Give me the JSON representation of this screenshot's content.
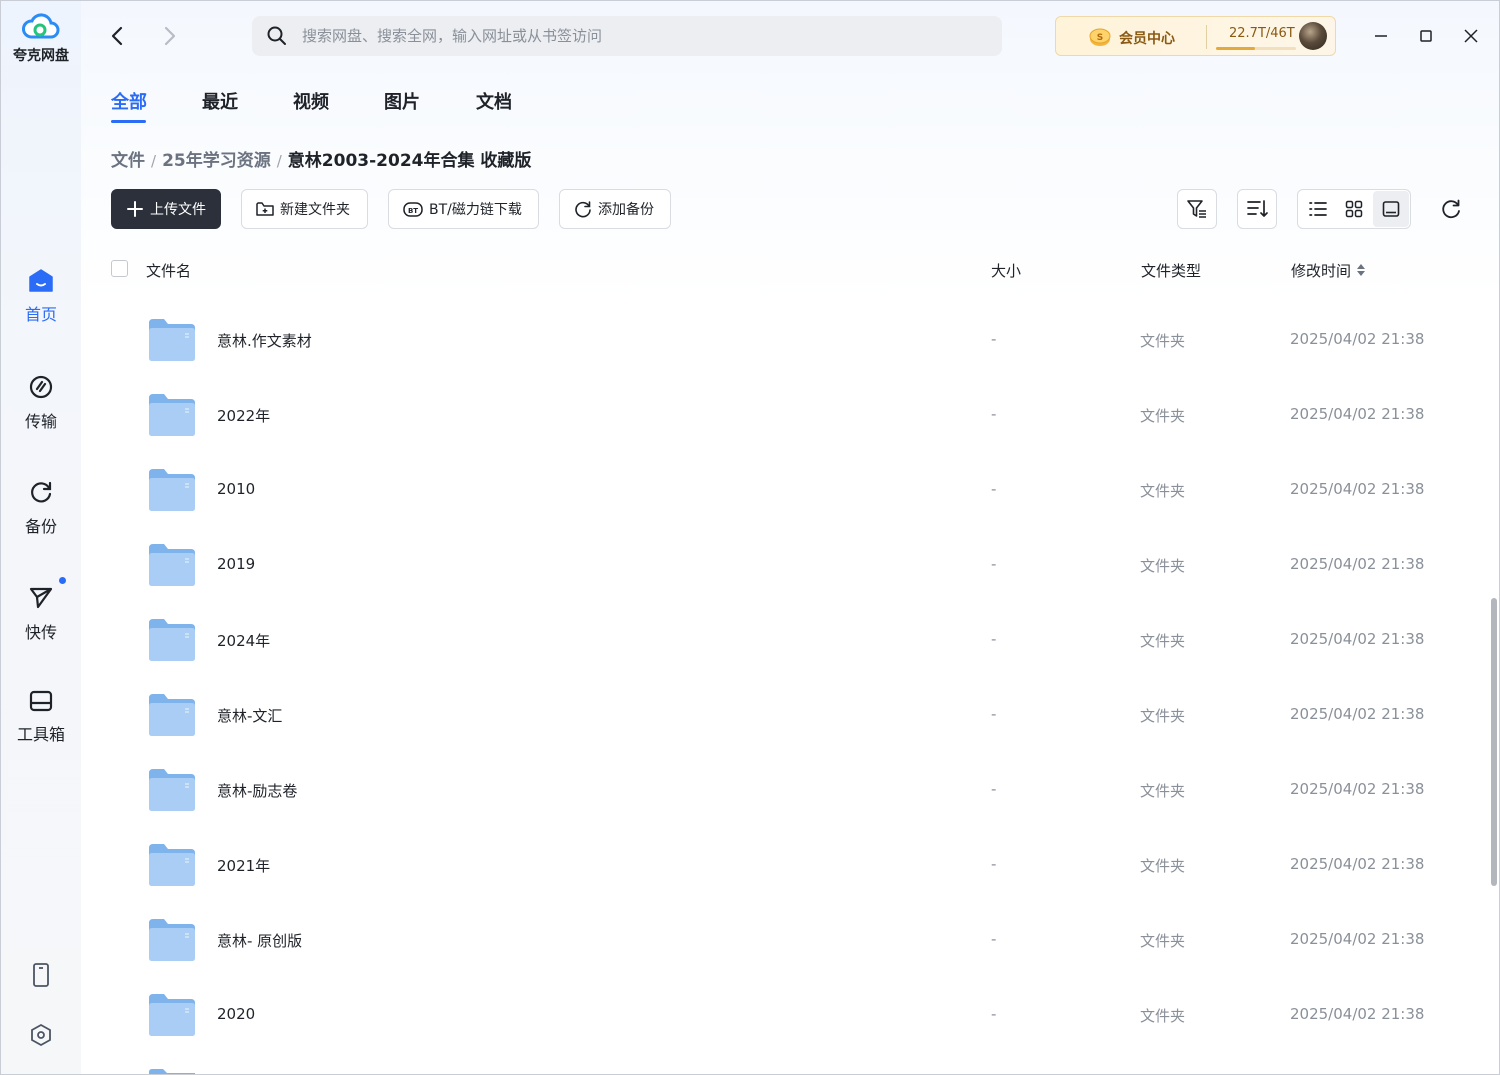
{
  "app": {
    "logo_text": "夸克网盘"
  },
  "colors": {
    "accent": "#2b6cf6",
    "primary_button": "#2b303b",
    "folder": "#7fb3ec",
    "vip_text": "#8a5a12"
  },
  "sidebar": {
    "items": [
      {
        "label": "首页",
        "icon": "home-icon",
        "active": true
      },
      {
        "label": "传输",
        "icon": "transfer-icon",
        "active": false
      },
      {
        "label": "备份",
        "icon": "backup-icon",
        "active": false
      },
      {
        "label": "快传",
        "icon": "send-icon",
        "active": false,
        "has_dot": true
      },
      {
        "label": "工具箱",
        "icon": "toolbox-icon",
        "active": false
      }
    ],
    "bottom_icons": [
      "phone-icon",
      "settings-icon"
    ]
  },
  "header": {
    "search_placeholder": "搜索网盘、搜索全网，输入网址或从书签访问",
    "vip_label": "会员中心",
    "storage": "22.7T/46T",
    "storage_used_fraction": 0.49
  },
  "tabs": [
    {
      "label": "全部",
      "active": true
    },
    {
      "label": "最近",
      "active": false
    },
    {
      "label": "视频",
      "active": false
    },
    {
      "label": "图片",
      "active": false
    },
    {
      "label": "文档",
      "active": false
    }
  ],
  "breadcrumb": {
    "items": [
      "文件",
      "25年学习资源"
    ],
    "separator": "/",
    "current": "意林2003-2024年合集 收藏版"
  },
  "toolbar": {
    "upload": "上传文件",
    "new_folder": "新建文件夹",
    "bt_download": "BT/磁力链下载",
    "add_backup": "添加备份"
  },
  "table": {
    "headers": {
      "name": "文件名",
      "size": "大小",
      "type": "文件类型",
      "modified": "修改时间"
    },
    "rows": [
      {
        "name": "意林.作文素材",
        "size": "-",
        "type": "文件夹",
        "modified": "2025/04/02 21:38"
      },
      {
        "name": "2022年",
        "size": "-",
        "type": "文件夹",
        "modified": "2025/04/02 21:38"
      },
      {
        "name": "2010",
        "size": "-",
        "type": "文件夹",
        "modified": "2025/04/02 21:38"
      },
      {
        "name": "2019",
        "size": "-",
        "type": "文件夹",
        "modified": "2025/04/02 21:38"
      },
      {
        "name": "2024年",
        "size": "-",
        "type": "文件夹",
        "modified": "2025/04/02 21:38"
      },
      {
        "name": "意林-文汇",
        "size": "-",
        "type": "文件夹",
        "modified": "2025/04/02 21:38"
      },
      {
        "name": "意林-励志卷",
        "size": "-",
        "type": "文件夹",
        "modified": "2025/04/02 21:38"
      },
      {
        "name": "2021年",
        "size": "-",
        "type": "文件夹",
        "modified": "2025/04/02 21:38"
      },
      {
        "name": "意林- 原创版",
        "size": "-",
        "type": "文件夹",
        "modified": "2025/04/02 21:38"
      },
      {
        "name": "2020",
        "size": "-",
        "type": "文件夹",
        "modified": "2025/04/02 21:38"
      }
    ]
  }
}
